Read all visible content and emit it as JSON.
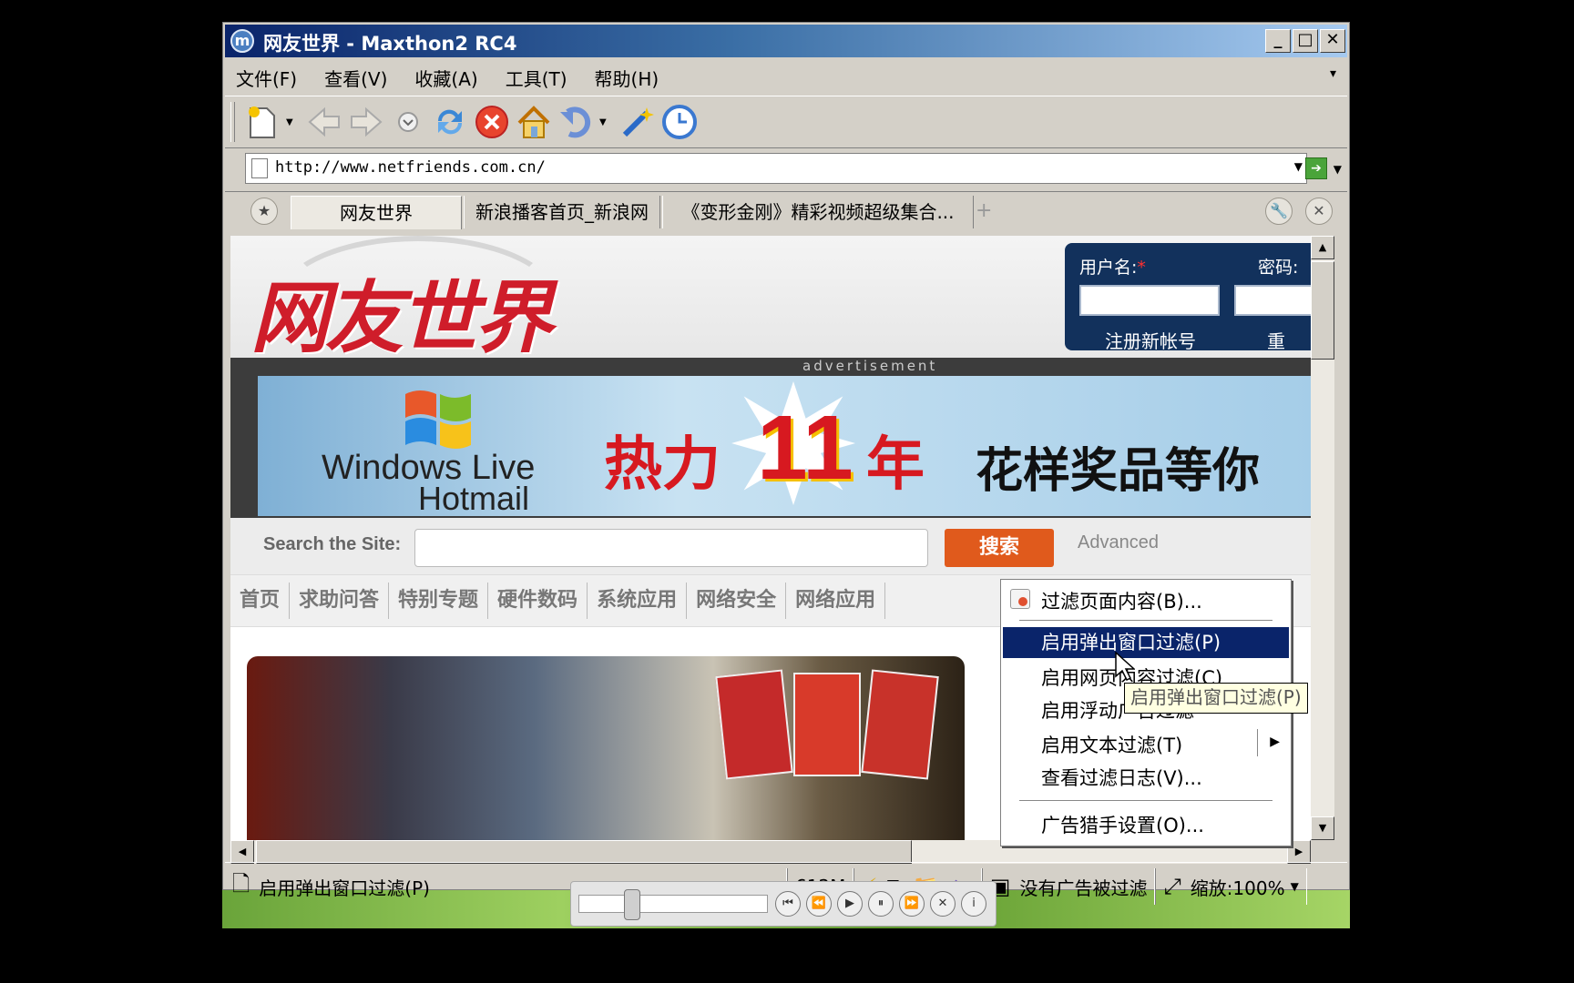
{
  "window": {
    "title": "网友世界 - Maxthon2 RC4",
    "app_icon": "maxthon-logo",
    "minimize": "_",
    "maximize": "□",
    "close": "✕"
  },
  "menu": {
    "items": [
      "文件(F)",
      "查看(V)",
      "收藏(A)",
      "工具(T)",
      "帮助(H)"
    ],
    "overflow": "▾"
  },
  "toolbar": {
    "icons": [
      "new-page-icon",
      "back-icon",
      "forward-icon",
      "history-dropdown-icon",
      "refresh-icon",
      "stop-icon",
      "home-icon",
      "undo-close-icon",
      "magic-wand-icon",
      "clock-icon"
    ]
  },
  "address": {
    "url": "http://www.netfriends.com.cn/"
  },
  "tabs": {
    "items": [
      {
        "label": "网友世界",
        "active": true
      },
      {
        "label": "新浪播客首页_新浪网",
        "active": false
      },
      {
        "label": "《变形金刚》精彩视频超级集合...",
        "active": false
      }
    ],
    "add": "+"
  },
  "page": {
    "logo": "网友世界",
    "login": {
      "user_label": "用户名:",
      "required_mark": "*",
      "pass_label": "密码:",
      "register": "注册新帐号",
      "reset": "重"
    },
    "ad": {
      "label": "advertisement",
      "brand_line1": "Windows Live",
      "brand_line2": "Hotmail",
      "slogan_left": "热力",
      "slogan_num": "11",
      "slogan_right": "年",
      "prize": "花样奖品等你"
    },
    "search": {
      "label": "Search the Site:",
      "button": "搜索",
      "advanced": "Advanced"
    },
    "nav": [
      "首页",
      "求助问答",
      "特别专题",
      "硬件数码",
      "系统应用",
      "网络安全",
      "网络应用"
    ]
  },
  "context_menu": {
    "items": [
      "过滤页面内容(B)...",
      "启用弹出窗口过滤(P)",
      "启用网页内容过滤(C)",
      "启用浮动广告过滤",
      "启用文本过滤(T)",
      "查看过滤日志(V)...",
      "广告猎手设置(O)..."
    ],
    "highlighted_index": 1,
    "tooltip": "启用弹出窗口过滤(P)"
  },
  "status": {
    "text": "启用弹出窗口过滤(P)",
    "memory": "612M",
    "adblock": "没有广告被过滤",
    "zoom": "缩放:100%"
  },
  "media": {
    "buttons": [
      "⏮",
      "⏪",
      "▶",
      "⏸",
      "⏩",
      "✕",
      "i"
    ],
    "position": 0.28
  }
}
